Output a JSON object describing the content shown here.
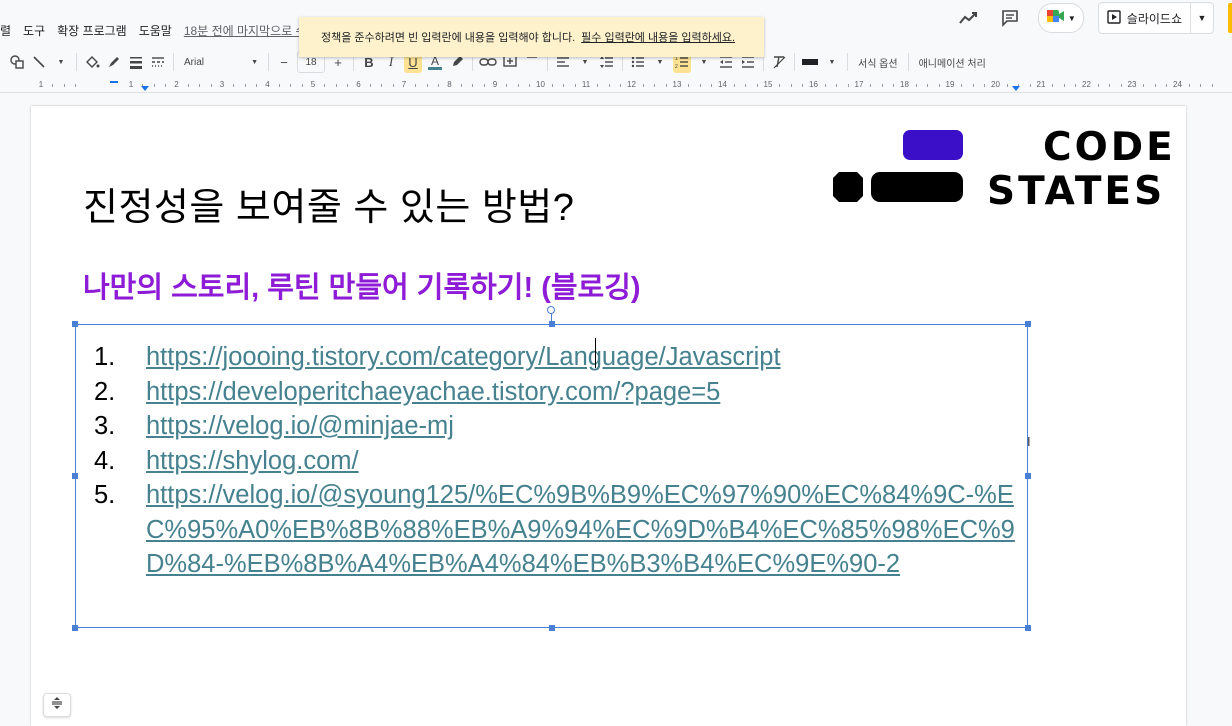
{
  "menu": {
    "items": [
      "렬",
      "도구",
      "확장 프로그램",
      "도움말"
    ],
    "last_edit": "18분 전에 마지막으로 수"
  },
  "toast": {
    "message": "정책을 준수하려면 빈 입력란에 내용을 입력해야 합니다.",
    "link": "필수 입력란에 내용을 입력하세요."
  },
  "header_right": {
    "slideshow_label": "슬라이드쇼"
  },
  "toolbar": {
    "font_name": "Arial",
    "font_size": "18",
    "format_options": "서식 옵션",
    "animation": "애니메이션 처리",
    "highlight_color": "#fde293"
  },
  "ruler": {
    "labels": [
      "1",
      "1",
      "2",
      "3",
      "4",
      "5",
      "6",
      "7",
      "8",
      "9",
      "10",
      "11",
      "12",
      "13",
      "14",
      "15",
      "16",
      "17",
      "18",
      "19",
      "20",
      "21",
      "22",
      "23",
      "24"
    ]
  },
  "slide": {
    "title": "진정성을 보여줄 수 있는 방법?",
    "subtitle": "나만의 스토리, 루틴 만들어 기록하기! (블로깅)",
    "subtitle_color": "#8e1bd6",
    "link_color": "#45818e",
    "logo": {
      "line1": "CODE",
      "line2": "STATES",
      "accent": "#3b0fc7"
    },
    "links": [
      {
        "num": "1.",
        "url": "https://joooing.tistory.com/category/Language/Javascript"
      },
      {
        "num": "2.",
        "url": "https://developeritchaeyachae.tistory.com/?page=5"
      },
      {
        "num": "3.",
        "url": "https://velog.io/@minjae-mj"
      },
      {
        "num": "4.",
        "url": "https://shylog.com/"
      },
      {
        "num": "5.",
        "url": "https://velog.io/@syoung125/%EC%9B%B9%EC%97%90%EC%84%9C-%EC%95%A0%EB%8B%88%EB%A9%94%EC%9D%B4%EC%85%98%EC%9D%84-%EB%8B%A4%EB%A4%84%EB%B3%B4%EC%9E%90-2"
      }
    ]
  }
}
